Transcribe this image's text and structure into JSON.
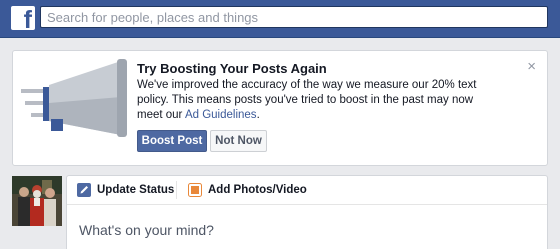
{
  "topbar": {
    "logo": "f",
    "search": {
      "placeholder": "Search for people, places and things",
      "value": ""
    }
  },
  "promo": {
    "title": "Try Boosting Your Posts Again",
    "body_line1": "We've improved the accuracy of the way we measure our 20% text",
    "body_line2": "policy. This means posts you've tried to boost in the past may now",
    "body_line3_prefix": "meet our ",
    "body_link": "Ad Guidelines",
    "body_line3_suffix": ".",
    "close": "×",
    "boost_label": "Boost Post",
    "dismiss_label": "Not Now",
    "icon": "megaphone-icon"
  },
  "composer": {
    "tab_status": {
      "label": "Update Status",
      "icon": "pencil-icon"
    },
    "tab_photos": {
      "label": "Add Photos/Video",
      "icon": "photo-icon"
    },
    "placeholder": "What's on your mind?"
  },
  "colors": {
    "brand": "#3b5998",
    "button_primary": "#4e69a2",
    "page_background": "#e9eaed",
    "photo_icon": "#e9883a"
  }
}
